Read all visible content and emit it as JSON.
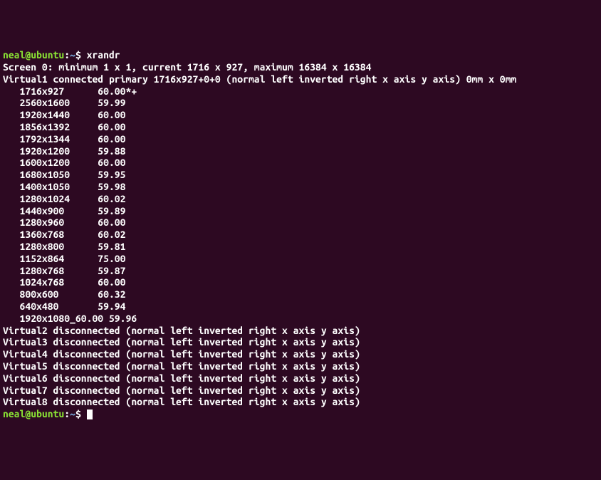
{
  "prompt": {
    "user_host": "neal@ubuntu",
    "colon": ":",
    "path": "~",
    "dollar": "$ "
  },
  "command": "xrandr",
  "screen_line": "Screen 0: minimum 1 x 1, current 1716 x 927, maximum 16384 x 16384",
  "virtual1_line": "Virtual1 connected primary 1716x927+0+0 (normal left inverted right x axis y axis) 0mm x 0mm",
  "modes": [
    {
      "res": "1716x927",
      "rate": "60.00*+"
    },
    {
      "res": "2560x1600",
      "rate": "59.99"
    },
    {
      "res": "1920x1440",
      "rate": "60.00"
    },
    {
      "res": "1856x1392",
      "rate": "60.00"
    },
    {
      "res": "1792x1344",
      "rate": "60.00"
    },
    {
      "res": "1920x1200",
      "rate": "59.88"
    },
    {
      "res": "1600x1200",
      "rate": "60.00"
    },
    {
      "res": "1680x1050",
      "rate": "59.95"
    },
    {
      "res": "1400x1050",
      "rate": "59.98"
    },
    {
      "res": "1280x1024",
      "rate": "60.02"
    },
    {
      "res": "1440x900",
      "rate": "59.89"
    },
    {
      "res": "1280x960",
      "rate": "60.00"
    },
    {
      "res": "1360x768",
      "rate": "60.02"
    },
    {
      "res": "1280x800",
      "rate": "59.81"
    },
    {
      "res": "1152x864",
      "rate": "75.00"
    },
    {
      "res": "1280x768",
      "rate": "59.87"
    },
    {
      "res": "1024x768",
      "rate": "60.00"
    },
    {
      "res": "800x600",
      "rate": "60.32"
    },
    {
      "res": "640x480",
      "rate": "59.94"
    },
    {
      "res": "1920x1080_60.00",
      "rate": "59.96"
    }
  ],
  "disconnected": [
    "Virtual2 disconnected (normal left inverted right x axis y axis)",
    "Virtual3 disconnected (normal left inverted right x axis y axis)",
    "Virtual4 disconnected (normal left inverted right x axis y axis)",
    "Virtual5 disconnected (normal left inverted right x axis y axis)",
    "Virtual6 disconnected (normal left inverted right x axis y axis)",
    "Virtual7 disconnected (normal left inverted right x axis y axis)",
    "Virtual8 disconnected (normal left inverted right x axis y axis)"
  ]
}
